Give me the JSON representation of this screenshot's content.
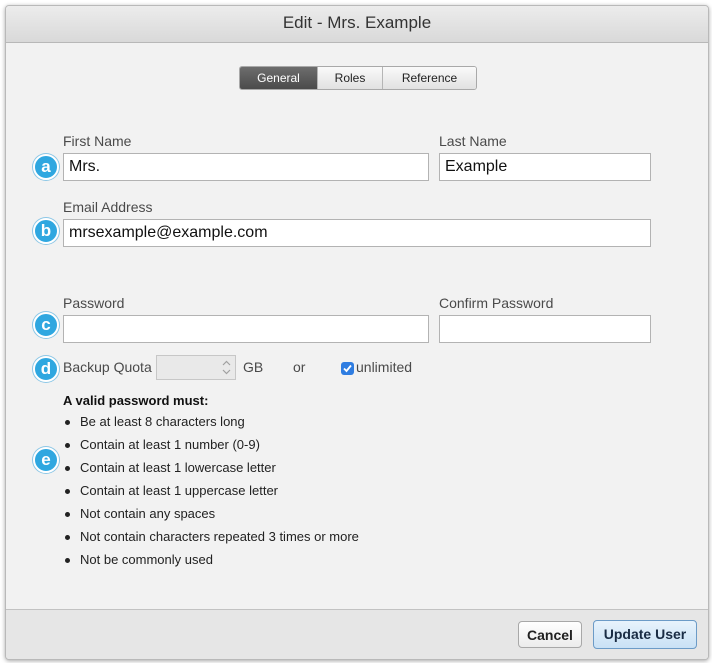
{
  "window": {
    "title": "Edit - Mrs. Example"
  },
  "tabs": [
    {
      "label": "General",
      "active": true
    },
    {
      "label": "Roles",
      "active": false
    },
    {
      "label": "Reference",
      "active": false
    }
  ],
  "form": {
    "first_name_label": "First Name",
    "first_name_value": "Mrs.",
    "last_name_label": "Last Name",
    "last_name_value": "Example",
    "email_label": "Email Address",
    "email_value": "mrsexample@example.com",
    "password_label": "Password",
    "password_value": "",
    "confirm_password_label": "Confirm Password",
    "confirm_password_value": "",
    "backup_quota_label": "Backup Quota",
    "backup_quota_value": "",
    "backup_quota_unit": "GB",
    "or_text": "or",
    "unlimited_label": "unlimited",
    "unlimited_checked": true
  },
  "password_rules": {
    "title": "A valid password must:",
    "items": [
      "Be at least 8 characters long",
      "Contain at least 1 number (0-9)",
      "Contain at least 1 lowercase letter",
      "Contain at least 1 uppercase letter",
      "Not contain any spaces",
      "Not contain characters repeated 3 times or more",
      "Not be commonly used"
    ]
  },
  "markers": [
    "a",
    "b",
    "c",
    "d",
    "e"
  ],
  "buttons": {
    "cancel": "Cancel",
    "update": "Update User"
  },
  "colors": {
    "accent": "#2fa7e0",
    "checkbox": "#2f7de1",
    "active_tab": "#555555",
    "primary_button": "#c9e1f5"
  }
}
